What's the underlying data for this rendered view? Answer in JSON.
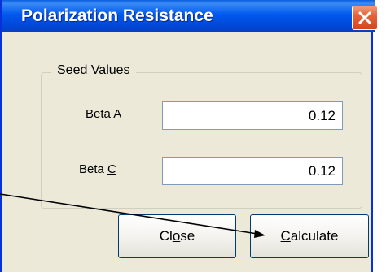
{
  "window": {
    "title": "Polarization Resistance"
  },
  "group": {
    "legend": "Seed Values",
    "fields": [
      {
        "label_prefix": "Beta ",
        "label_accel": "A",
        "label_suffix": "",
        "value": "0.12"
      },
      {
        "label_prefix": "Beta ",
        "label_accel": "C",
        "label_suffix": "",
        "value": "0.12"
      }
    ]
  },
  "buttons": {
    "close": {
      "accel": "",
      "mid": "C",
      "rest": "lose",
      "prefix_before_ul": "Cl",
      "ul": "o",
      "suffix": "se"
    },
    "calculate": {
      "prefix": "",
      "ul": "C",
      "suffix": "alculate"
    }
  },
  "icons": {
    "close_icon": "close-x-icon",
    "annotation_arrow": "arrow-right-icon"
  },
  "colors": {
    "titlebar": "#0058ee",
    "close_button": "#e4633b",
    "dialog_bg": "#ece9d8",
    "button_border": "#003c74"
  }
}
